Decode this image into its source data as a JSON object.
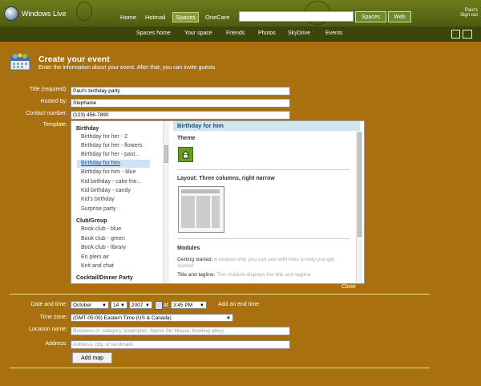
{
  "header": {
    "logo_text": "Windows Live",
    "nav": [
      "Home",
      "Hotmail",
      "Spaces",
      "OneCare"
    ],
    "search_placeholder": "",
    "search_buttons": [
      "Spaces",
      "Web"
    ],
    "user_lines": [
      "Paul's",
      "Sign out"
    ]
  },
  "subnav": [
    "Spaces home",
    "Your space",
    "Friends",
    "Photos",
    "SkyDrive",
    "Events"
  ],
  "page": {
    "title": "Create your event",
    "subtitle": "Enter the information about your event. After that, you can invite guests."
  },
  "form": {
    "title_label": "Title (required):",
    "title_value": "Paul's birthday party",
    "hosted_label": "Hosted by:",
    "hosted_value": "Stephanie",
    "contact_label": "Contact number:",
    "contact_value": "(123) 456-7890",
    "template_label": "Template:"
  },
  "templates": {
    "categories": [
      {
        "name": "Birthday",
        "items": [
          "Birthday for her - 2",
          "Birthday for her - flowers",
          "Birthday for her - past...",
          "Birthday for him",
          "Birthday for him - blue",
          "Kid birthday - cake frie...",
          "Kid birthday - candy",
          "Kid's birthday",
          "Surprise party"
        ]
      },
      {
        "name": "Club/Group",
        "items": [
          "Book club - blue",
          "Book club - green",
          "Book club - library",
          "En plein air",
          "Knit and chat"
        ]
      },
      {
        "name": "Cocktail/Dinner Party",
        "items": []
      }
    ],
    "selected": "Birthday for him"
  },
  "detail": {
    "header": "Birthday for him",
    "theme_label": "Theme",
    "layout_label": "Layout: Three columns, right narrow",
    "modules_label": "Modules",
    "module1_name": "Getting started:",
    "module1_desc": "A module only you can see with links to help you get started",
    "module2_name": "Title and tagline:",
    "module2_desc": "This module displays the title and tagline"
  },
  "close_label": "Close",
  "datetime": {
    "label": "Date and time:",
    "month": "October",
    "day": "14",
    "year": "2007",
    "at": "at",
    "time": "3:45 PM",
    "add_end": "Add an end time"
  },
  "timezone": {
    "label": "Time zone:",
    "value": "(GMT-05:00) Eastern Time (US & Canada)"
  },
  "location": {
    "label": "Location name:",
    "placeholder": "Business or category (examples: Alpine Ski House, bowling alley)"
  },
  "address": {
    "label": "Address:",
    "placeholder": "Address, city, or landmark"
  },
  "add_map_label": "Add map",
  "colors": {
    "background": "#a8700f",
    "header": "#5b6816",
    "subnav": "#3c4608",
    "selected": "#cfe2f6"
  }
}
